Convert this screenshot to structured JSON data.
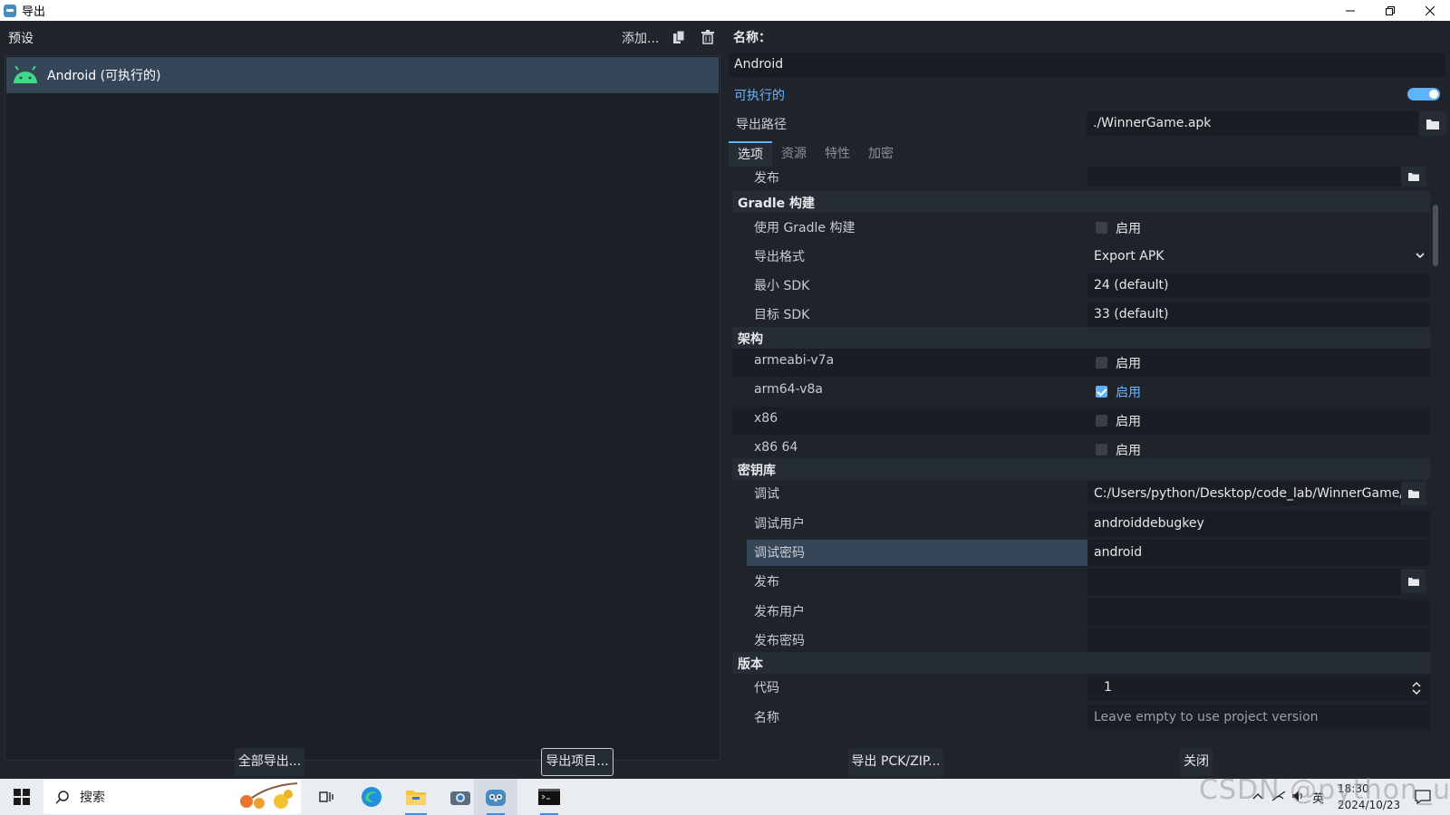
{
  "window": {
    "title": "导出"
  },
  "presets": {
    "header_label": "预设",
    "add_label": "添加...",
    "items": [
      {
        "label": "Android (可执行的)"
      }
    ]
  },
  "details": {
    "name_label": "名称：",
    "name_value": "Android",
    "runnable_label": "可执行的",
    "export_path_label": "导出路径",
    "export_path_value": "./WinnerGame.apk",
    "tabs": [
      "选项",
      "资源",
      "特性",
      "加密"
    ]
  },
  "options": {
    "top_release_label": "发布",
    "gradle": {
      "title": "Gradle 构建",
      "use_gradle_label": "使用 Gradle 构建",
      "use_gradle_value": "启用",
      "export_format_label": "导出格式",
      "export_format_value": "Export APK",
      "min_sdk_label": "最小 SDK",
      "min_sdk_value": "24 (default)",
      "target_sdk_label": "目标 SDK",
      "target_sdk_value": "33 (default)"
    },
    "arch": {
      "title": "架构",
      "items": [
        {
          "label": "armeabi-v7a",
          "value": "启用",
          "checked": false
        },
        {
          "label": "arm64-v8a",
          "value": "启用",
          "checked": true
        },
        {
          "label": "x86",
          "value": "启用",
          "checked": false
        },
        {
          "label": "x86 64",
          "value": "启用",
          "checked": false
        }
      ]
    },
    "keystore": {
      "title": "密钥库",
      "debug_label": "调试",
      "debug_value": "C:/Users/python/Desktop/code_lab/WinnerGame/",
      "debug_user_label": "调试用户",
      "debug_user_value": "androiddebugkey",
      "debug_password_label": "调试密码",
      "debug_password_value": "android",
      "release_label": "发布",
      "release_value": "",
      "release_user_label": "发布用户",
      "release_user_value": "",
      "release_password_label": "发布密码",
      "release_password_value": ""
    },
    "version": {
      "title": "版本",
      "code_label": "代码",
      "code_value": "1",
      "name_label": "名称",
      "name_placeholder": "Leave empty to use project version"
    }
  },
  "footer": {
    "export_all": "全部导出...",
    "export_project": "导出项目...",
    "export_pck": "导出 PCK/ZIP...",
    "close": "关闭"
  },
  "taskbar": {
    "search_label": "搜索",
    "time": "18:30",
    "date": "2024/10/23",
    "ime": "英"
  },
  "watermark": "CSDN @python_use",
  "colors": {
    "accent": "#5fb2ff",
    "selected_row": "#364659",
    "background": "#20252c"
  }
}
